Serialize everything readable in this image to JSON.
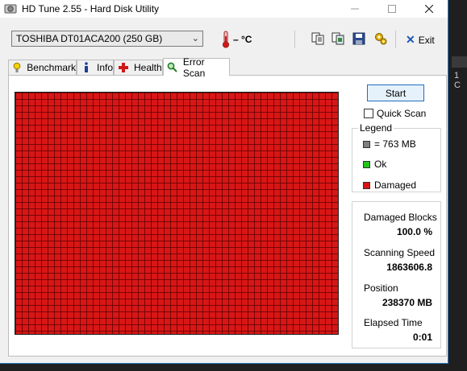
{
  "window": {
    "title": "HD Tune 2.55 - Hard Disk Utility"
  },
  "toolbar": {
    "drive": "TOSHIBA DT01ACA200 (250 GB)",
    "temperature": "– °C",
    "exit_label": "Exit"
  },
  "tabs": [
    {
      "label": "Benchmark"
    },
    {
      "label": "Info"
    },
    {
      "label": "Health"
    },
    {
      "label": "Error Scan"
    }
  ],
  "scan": {
    "start_label": "Start",
    "quick_scan_label": "Quick Scan",
    "quick_scan_checked": false,
    "block_status": "damaged",
    "block_color": "#d81616"
  },
  "legend": {
    "title": "Legend",
    "block_size": "= 763 MB",
    "ok": "Ok",
    "damaged": "Damaged",
    "colors": {
      "block": "#7f7f7f",
      "ok": "#22c41c",
      "damaged": "#d81616"
    }
  },
  "stats": {
    "damaged_blocks_label": "Damaged Blocks",
    "damaged_blocks_value": "100.0 %",
    "speed_label": "Scanning Speed",
    "speed_value": "1863606.8",
    "position_label": "Position",
    "position_value": "238370 MB",
    "elapsed_label": "Elapsed Time",
    "elapsed_value": "0:01"
  },
  "background": {
    "side_text": "1 C"
  }
}
